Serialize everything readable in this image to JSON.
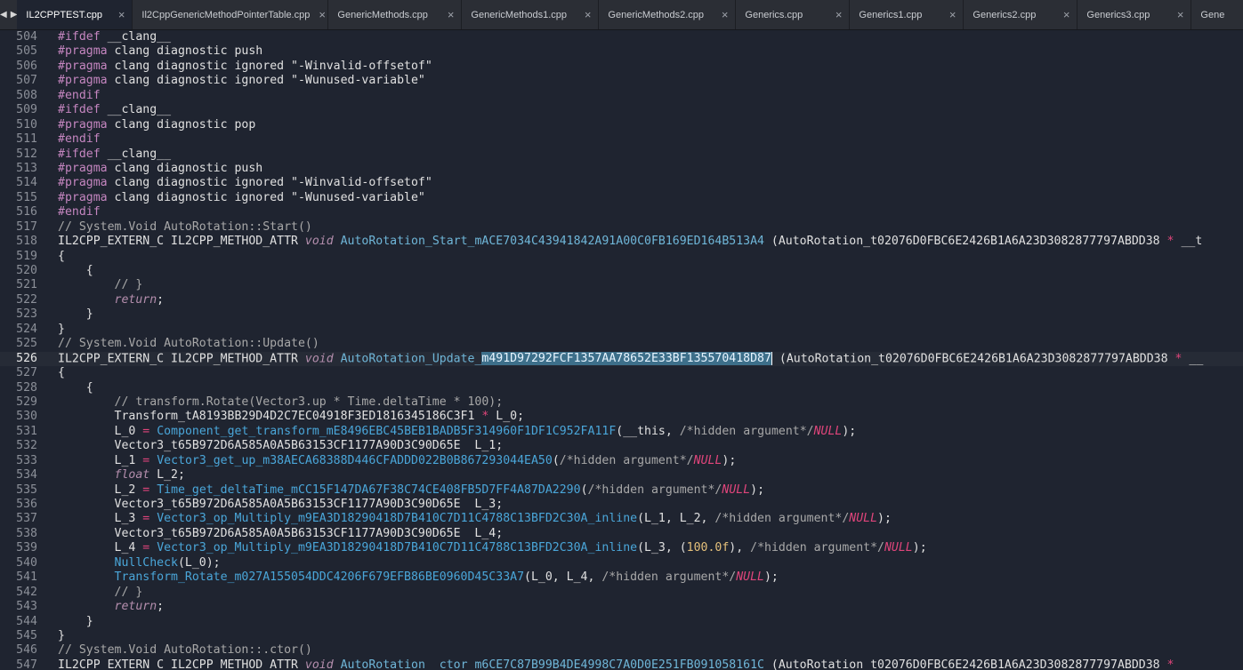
{
  "tabs": [
    {
      "label": "IL2CPPTEST.cpp",
      "active": true,
      "width": 130
    },
    {
      "label": "Il2CppGenericMethodPointerTable.cpp",
      "active": false,
      "width": 220
    },
    {
      "label": "GenericMethods.cpp",
      "active": false,
      "width": 150
    },
    {
      "label": "GenericMethods1.cpp",
      "active": false,
      "width": 154
    },
    {
      "label": "GenericMethods2.cpp",
      "active": false,
      "width": 154
    },
    {
      "label": "Generics.cpp",
      "active": false,
      "width": 128
    },
    {
      "label": "Generics1.cpp",
      "active": false,
      "width": 128
    },
    {
      "label": "Generics2.cpp",
      "active": false,
      "width": 128
    },
    {
      "label": "Generics3.cpp",
      "active": false,
      "width": 128
    },
    {
      "label": "Gene",
      "active": false,
      "width": 60
    }
  ],
  "nav": {
    "back": "◀",
    "forward": "▶"
  },
  "close_glyph": "×",
  "current_line": 526,
  "lines": [
    {
      "n": 504,
      "t": [
        [
          "pp",
          "#ifdef"
        ],
        [
          "plain",
          " __clang__"
        ]
      ]
    },
    {
      "n": 505,
      "t": [
        [
          "pp",
          "#pragma"
        ],
        [
          "plain",
          " clang diagnostic push"
        ]
      ]
    },
    {
      "n": 506,
      "t": [
        [
          "pp",
          "#pragma"
        ],
        [
          "plain",
          " clang diagnostic ignored \"-Winvalid-offsetof\""
        ]
      ]
    },
    {
      "n": 507,
      "t": [
        [
          "pp",
          "#pragma"
        ],
        [
          "plain",
          " clang diagnostic ignored \"-Wunused-variable\""
        ]
      ]
    },
    {
      "n": 508,
      "t": [
        [
          "pp",
          "#endif"
        ]
      ]
    },
    {
      "n": 509,
      "t": [
        [
          "pp",
          "#ifdef"
        ],
        [
          "plain",
          " __clang__"
        ]
      ]
    },
    {
      "n": 510,
      "t": [
        [
          "pp",
          "#pragma"
        ],
        [
          "plain",
          " clang diagnostic pop"
        ]
      ]
    },
    {
      "n": 511,
      "t": [
        [
          "pp",
          "#endif"
        ]
      ]
    },
    {
      "n": 512,
      "t": [
        [
          "pp",
          "#ifdef"
        ],
        [
          "plain",
          " __clang__"
        ]
      ]
    },
    {
      "n": 513,
      "t": [
        [
          "pp",
          "#pragma"
        ],
        [
          "plain",
          " clang diagnostic push"
        ]
      ]
    },
    {
      "n": 514,
      "t": [
        [
          "pp",
          "#pragma"
        ],
        [
          "plain",
          " clang diagnostic ignored \"-Winvalid-offsetof\""
        ]
      ]
    },
    {
      "n": 515,
      "t": [
        [
          "pp",
          "#pragma"
        ],
        [
          "plain",
          " clang diagnostic ignored \"-Wunused-variable\""
        ]
      ]
    },
    {
      "n": 516,
      "t": [
        [
          "pp",
          "#endif"
        ]
      ]
    },
    {
      "n": 517,
      "t": [
        [
          "cm",
          "// System.Void AutoRotation::Start()"
        ]
      ]
    },
    {
      "n": 518,
      "t": [
        [
          "plain",
          "IL2CPP_EXTERN_C IL2CPP_METHOD_ATTR "
        ],
        [
          "kw",
          "void"
        ],
        [
          "plain",
          " "
        ],
        [
          "fn",
          "AutoRotation_Start_mACE7034C43941842A91A00C0FB169ED164B513A4"
        ],
        [
          "plain",
          " (AutoRotation_t02076D0FBC6E2426B1A6A23D3082877797ABDD38 "
        ],
        [
          "op",
          "*"
        ],
        [
          "plain",
          " __t"
        ]
      ]
    },
    {
      "n": 519,
      "t": [
        [
          "plain",
          "{"
        ]
      ]
    },
    {
      "n": 520,
      "t": [
        [
          "plain",
          "    {"
        ]
      ]
    },
    {
      "n": 521,
      "t": [
        [
          "cm",
          "        // }"
        ]
      ]
    },
    {
      "n": 522,
      "t": [
        [
          "kw",
          "        return"
        ],
        [
          "plain",
          ";"
        ]
      ]
    },
    {
      "n": 523,
      "t": [
        [
          "plain",
          "    }"
        ]
      ]
    },
    {
      "n": 524,
      "t": [
        [
          "plain",
          "}"
        ]
      ]
    },
    {
      "n": 525,
      "t": [
        [
          "cm",
          "// System.Void AutoRotation::Update()"
        ]
      ]
    },
    {
      "n": 526,
      "t": [
        [
          "plain",
          "IL2CPP_EXTERN_C IL2CPP_METHOD_ATTR "
        ],
        [
          "kw",
          "void"
        ],
        [
          "plain",
          " "
        ],
        [
          "fn",
          "AutoRotation_Update_"
        ],
        [
          "sel",
          "m491D97292FCF1357AA78652E33BF135570418D87"
        ],
        [
          "caret",
          ""
        ],
        [
          "plain",
          " (AutoRotation_t02076D0FBC6E2426B1A6A23D3082877797ABDD38 "
        ],
        [
          "op",
          "*"
        ],
        [
          "plain",
          " __"
        ]
      ]
    },
    {
      "n": 527,
      "t": [
        [
          "plain",
          "{"
        ]
      ]
    },
    {
      "n": 528,
      "t": [
        [
          "plain",
          "    {"
        ]
      ]
    },
    {
      "n": 529,
      "t": [
        [
          "cm",
          "        // transform.Rotate(Vector3.up * Time.deltaTime * 100);"
        ]
      ]
    },
    {
      "n": 530,
      "t": [
        [
          "plain",
          "        Transform_tA8193BB29D4D2C7EC04918F3ED1816345186C3F1 "
        ],
        [
          "op",
          "*"
        ],
        [
          "plain",
          " L_0;"
        ]
      ]
    },
    {
      "n": 531,
      "t": [
        [
          "plain",
          "        L_0 "
        ],
        [
          "op",
          "="
        ],
        [
          "plain",
          " "
        ],
        [
          "fnc",
          "Component_get_transform_mE8496EBC45BEB1BADB5F314960F1DF1C952FA11F"
        ],
        [
          "plain",
          "(__this, "
        ],
        [
          "cm",
          "/*hidden argument*/"
        ],
        [
          "null",
          "NULL"
        ],
        [
          "plain",
          ");"
        ]
      ]
    },
    {
      "n": 532,
      "t": [
        [
          "plain",
          "        Vector3_t65B972D6A585A0A5B63153CF1177A90D3C90D65E  L_1;"
        ]
      ]
    },
    {
      "n": 533,
      "t": [
        [
          "plain",
          "        L_1 "
        ],
        [
          "op",
          "="
        ],
        [
          "plain",
          " "
        ],
        [
          "fnc",
          "Vector3_get_up_m38AECA68388D446CFADDD022B0B867293044EA50"
        ],
        [
          "plain",
          "("
        ],
        [
          "cm",
          "/*hidden argument*/"
        ],
        [
          "null",
          "NULL"
        ],
        [
          "plain",
          ");"
        ]
      ]
    },
    {
      "n": 534,
      "t": [
        [
          "kw",
          "        float"
        ],
        [
          "plain",
          " L_2;"
        ]
      ]
    },
    {
      "n": 535,
      "t": [
        [
          "plain",
          "        L_2 "
        ],
        [
          "op",
          "="
        ],
        [
          "plain",
          " "
        ],
        [
          "fnc",
          "Time_get_deltaTime_mCC15F147DA67F38C74CE408FB5D7FF4A87DA2290"
        ],
        [
          "plain",
          "("
        ],
        [
          "cm",
          "/*hidden argument*/"
        ],
        [
          "null",
          "NULL"
        ],
        [
          "plain",
          ");"
        ]
      ]
    },
    {
      "n": 536,
      "t": [
        [
          "plain",
          "        Vector3_t65B972D6A585A0A5B63153CF1177A90D3C90D65E  L_3;"
        ]
      ]
    },
    {
      "n": 537,
      "t": [
        [
          "plain",
          "        L_3 "
        ],
        [
          "op",
          "="
        ],
        [
          "plain",
          " "
        ],
        [
          "fnc",
          "Vector3_op_Multiply_m9EA3D18290418D7B410C7D11C4788C13BFD2C30A_inline"
        ],
        [
          "plain",
          "(L_1, L_2, "
        ],
        [
          "cm",
          "/*hidden argument*/"
        ],
        [
          "null",
          "NULL"
        ],
        [
          "plain",
          ");"
        ]
      ]
    },
    {
      "n": 538,
      "t": [
        [
          "plain",
          "        Vector3_t65B972D6A585A0A5B63153CF1177A90D3C90D65E  L_4;"
        ]
      ]
    },
    {
      "n": 539,
      "t": [
        [
          "plain",
          "        L_4 "
        ],
        [
          "op",
          "="
        ],
        [
          "plain",
          " "
        ],
        [
          "fnc",
          "Vector3_op_Multiply_m9EA3D18290418D7B410C7D11C4788C13BFD2C30A_inline"
        ],
        [
          "plain",
          "(L_3, ("
        ],
        [
          "num",
          "100.0f"
        ],
        [
          "plain",
          "), "
        ],
        [
          "cm",
          "/*hidden argument*/"
        ],
        [
          "null",
          "NULL"
        ],
        [
          "plain",
          ");"
        ]
      ]
    },
    {
      "n": 540,
      "t": [
        [
          "fnc",
          "        NullCheck"
        ],
        [
          "plain",
          "(L_0);"
        ]
      ]
    },
    {
      "n": 541,
      "t": [
        [
          "fnc",
          "        Transform_Rotate_m027A155054DDC4206F679EFB86BE0960D45C33A7"
        ],
        [
          "plain",
          "(L_0, L_4, "
        ],
        [
          "cm",
          "/*hidden argument*/"
        ],
        [
          "null",
          "NULL"
        ],
        [
          "plain",
          ");"
        ]
      ]
    },
    {
      "n": 542,
      "t": [
        [
          "cm",
          "        // }"
        ]
      ]
    },
    {
      "n": 543,
      "t": [
        [
          "kw",
          "        return"
        ],
        [
          "plain",
          ";"
        ]
      ]
    },
    {
      "n": 544,
      "t": [
        [
          "plain",
          "    }"
        ]
      ]
    },
    {
      "n": 545,
      "t": [
        [
          "plain",
          "}"
        ]
      ]
    },
    {
      "n": 546,
      "t": [
        [
          "cm",
          "// System.Void AutoRotation::.ctor()"
        ]
      ]
    },
    {
      "n": 547,
      "t": [
        [
          "plain",
          "IL2CPP_EXTERN_C IL2CPP_METHOD_ATTR "
        ],
        [
          "kw",
          "void"
        ],
        [
          "plain",
          " "
        ],
        [
          "fn",
          "AutoRotation__ctor_m6CE7C87B99B4DE4998C7A0D0E251FB091058161C"
        ],
        [
          "plain",
          " (AutoRotation_t02076D0FBC6E2426B1A6A23D3082877797ABDD38 "
        ],
        [
          "op",
          "*"
        ],
        [
          "plain",
          " __"
        ]
      ]
    }
  ]
}
